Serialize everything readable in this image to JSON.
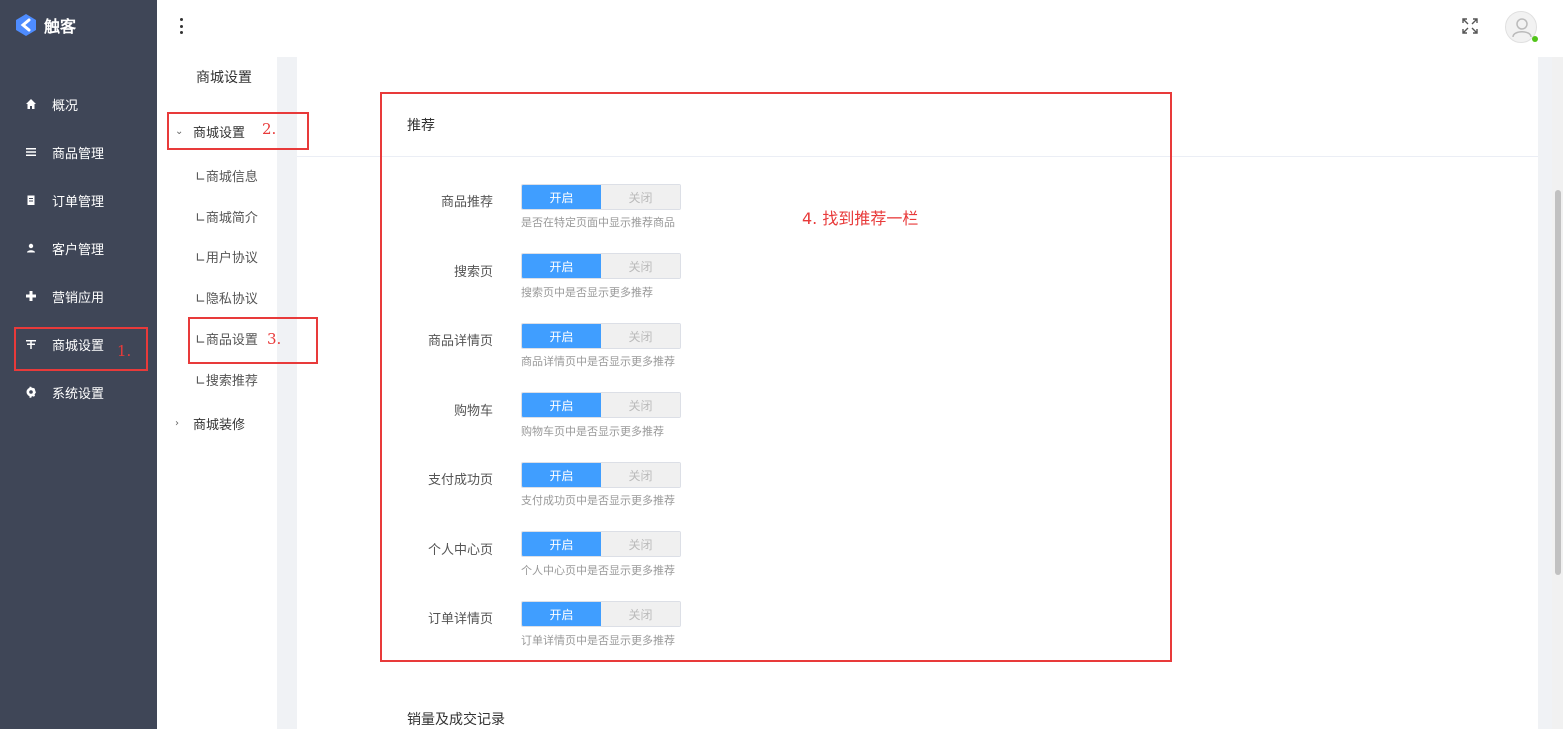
{
  "app": {
    "logo_text": "触客"
  },
  "sidebar": {
    "items": [
      {
        "label": "概况",
        "icon": "home-icon"
      },
      {
        "label": "商品管理",
        "icon": "list-icon"
      },
      {
        "label": "订单管理",
        "icon": "clipboard-icon"
      },
      {
        "label": "客户管理",
        "icon": "user-icon"
      },
      {
        "label": "营销应用",
        "icon": "gamepad-icon"
      },
      {
        "label": "商城设置",
        "icon": "shop-icon"
      },
      {
        "label": "系统设置",
        "icon": "gear-icon"
      }
    ]
  },
  "submenu": {
    "title": "商城设置",
    "group_expanded": "商城设置",
    "items": [
      "∟商城信息",
      "∟商城简介",
      "∟用户协议",
      "∟隐私协议",
      "∟商品设置",
      "∟搜索推荐"
    ],
    "group_collapsed": "商城装修"
  },
  "main": {
    "section_title": "推荐",
    "rows": [
      {
        "label": "商品推荐",
        "on": "开启",
        "off": "关闭",
        "desc": "是否在特定页面中显示推荐商品"
      },
      {
        "label": "搜索页",
        "on": "开启",
        "off": "关闭",
        "desc": "搜索页中是否显示更多推荐"
      },
      {
        "label": "商品详情页",
        "on": "开启",
        "off": "关闭",
        "desc": "商品详情页中是否显示更多推荐"
      },
      {
        "label": "购物车",
        "on": "开启",
        "off": "关闭",
        "desc": "购物车页中是否显示更多推荐"
      },
      {
        "label": "支付成功页",
        "on": "开启",
        "off": "关闭",
        "desc": "支付成功页中是否显示更多推荐"
      },
      {
        "label": "个人中心页",
        "on": "开启",
        "off": "关闭",
        "desc": "个人中心页中是否显示更多推荐"
      },
      {
        "label": "订单详情页",
        "on": "开启",
        "off": "关闭",
        "desc": "订单详情页中是否显示更多推荐"
      }
    ],
    "section_title_2": "销量及成交记录"
  },
  "annotations": {
    "step1": "1.",
    "step2": "2.",
    "step3": "3.",
    "step4": "4. 找到推荐一栏"
  },
  "colors": {
    "sidebar_bg": "#3f4657",
    "accent": "#409eff",
    "annotation": "#e83a3a"
  }
}
